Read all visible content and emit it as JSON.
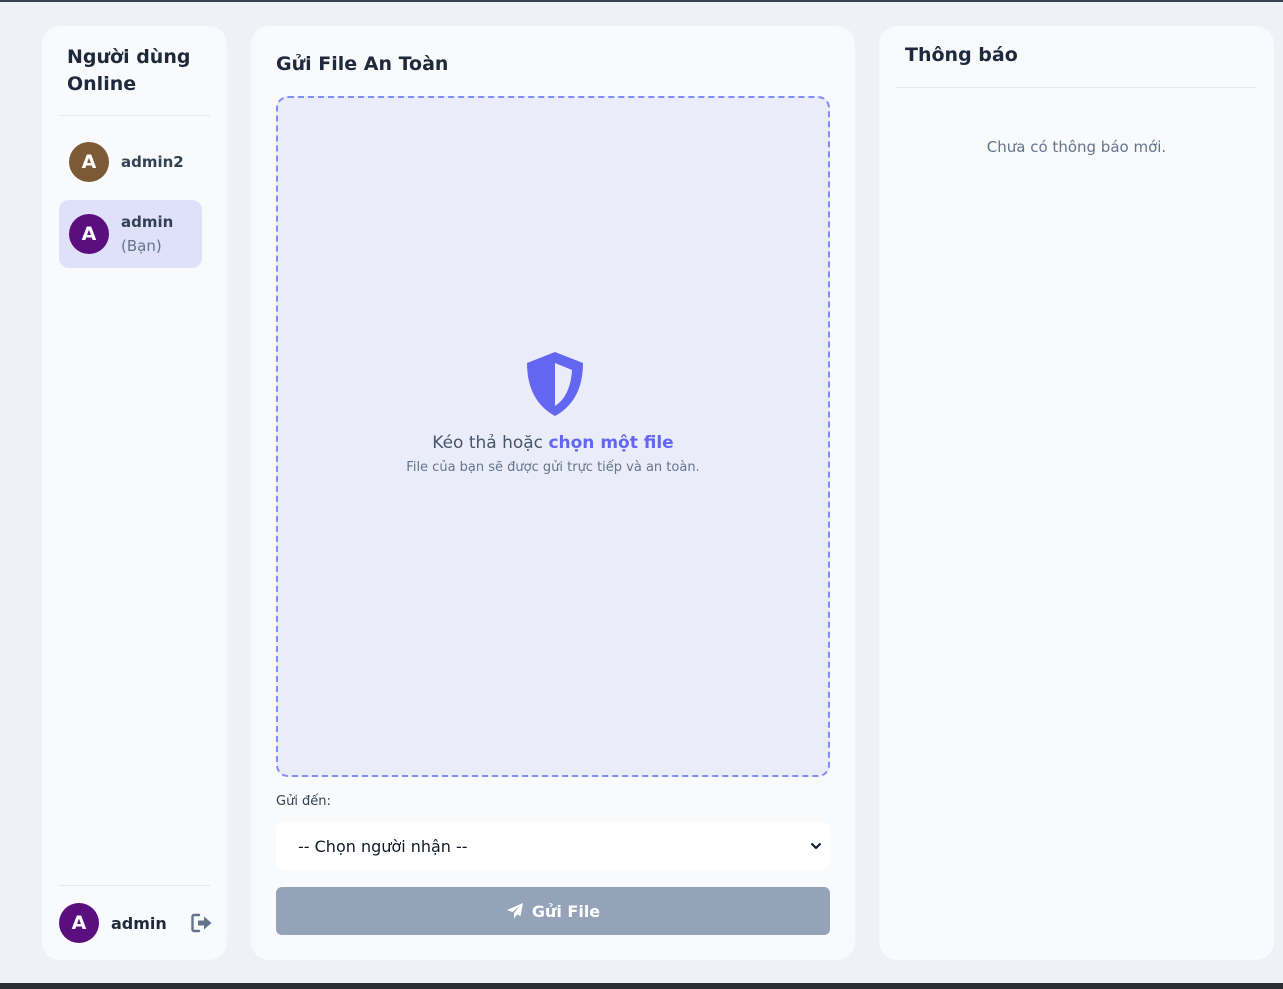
{
  "colors": {
    "background": "#eef2f7",
    "panel": "#f8fafc",
    "accent": "#6366f1",
    "dropzone_bg": "#eaecf9",
    "dropzone_border": "#818cf8",
    "selected_user_bg": "#dfe0fa",
    "button_disabled": "#94a3b8",
    "avatar_admin2": "#7c5a36",
    "avatar_admin": "#5b0f7e"
  },
  "online_users": {
    "title": "Người dùng Online",
    "users": [
      {
        "avatar_letter": "A",
        "name": "admin2",
        "suffix": ""
      },
      {
        "avatar_letter": "A",
        "name": "admin",
        "suffix": "(Bạn)",
        "selected": true
      }
    ],
    "current_user": {
      "avatar_letter": "A",
      "name": "admin",
      "logout_icon": "logout-icon"
    }
  },
  "send_file": {
    "title": "Gửi File An Toàn",
    "dropzone": {
      "icon": "shield-icon",
      "prompt": "Kéo thả hoặc",
      "link": "chọn một file",
      "subtext": "File của bạn sẽ được gửi trực tiếp và an toàn."
    },
    "recipient_label": "Gửi đến:",
    "recipient_select": {
      "selected": "-- Chọn người nhận --"
    },
    "send_button": {
      "label": "Gửi File",
      "icon": "paper-plane-icon",
      "disabled": true
    }
  },
  "notifications": {
    "title": "Thông báo",
    "empty_text": "Chưa có thông báo mới."
  }
}
